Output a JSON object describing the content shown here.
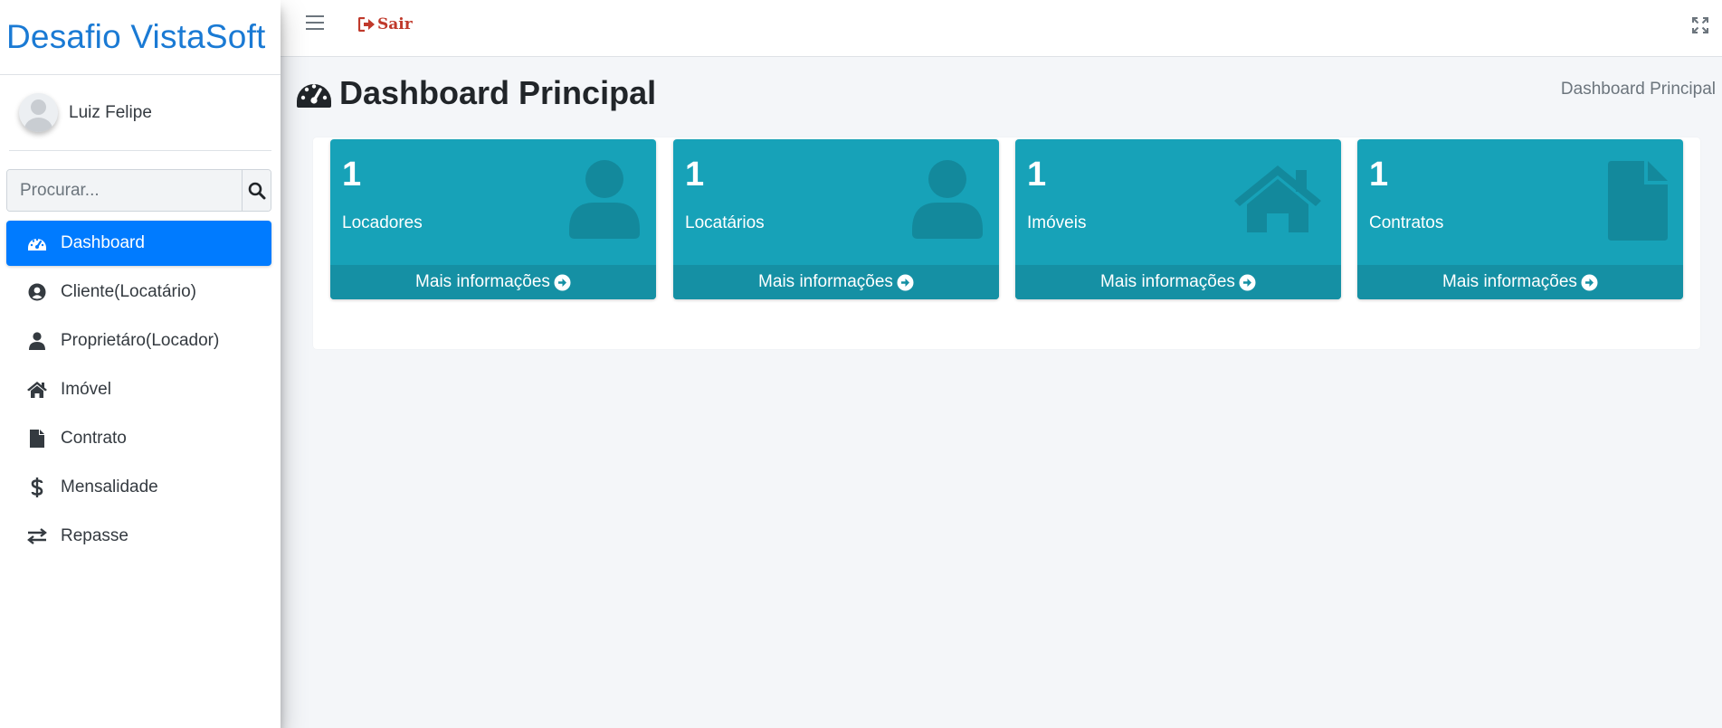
{
  "brand": {
    "title": "Desafio VistaSoft"
  },
  "user": {
    "name": "Luiz Felipe"
  },
  "search": {
    "placeholder": "Procurar..."
  },
  "nav": {
    "items": [
      {
        "label": "Dashboard",
        "icon": "gauge-icon",
        "active": true
      },
      {
        "label": "Cliente(Locatário)",
        "icon": "user-circle-icon"
      },
      {
        "label": "Proprietáro(Locador)",
        "icon": "user-icon"
      },
      {
        "label": "Imóvel",
        "icon": "home-icon"
      },
      {
        "label": "Contrato",
        "icon": "file-icon"
      },
      {
        "label": "Mensalidade",
        "icon": "dollar-icon"
      },
      {
        "label": "Repasse",
        "icon": "exchange-icon"
      }
    ]
  },
  "topbar": {
    "logout_label": "Sair"
  },
  "header": {
    "title": "Dashboard Principal",
    "breadcrumb": "Dashboard Principal"
  },
  "boxes": [
    {
      "count": "1",
      "label": "Locadores",
      "footer": "Mais informações",
      "icon": "user-icon"
    },
    {
      "count": "1",
      "label": "Locatários",
      "footer": "Mais informações",
      "icon": "user-icon"
    },
    {
      "count": "1",
      "label": "Imóveis",
      "footer": "Mais informações",
      "icon": "home-icon"
    },
    {
      "count": "1",
      "label": "Contratos",
      "footer": "Mais informações",
      "icon": "file-icon"
    }
  ],
  "colors": {
    "accent": "#007bff",
    "info_box": "#17a2b8",
    "brand": "#1a7ad4",
    "logout": "#c0392b"
  }
}
